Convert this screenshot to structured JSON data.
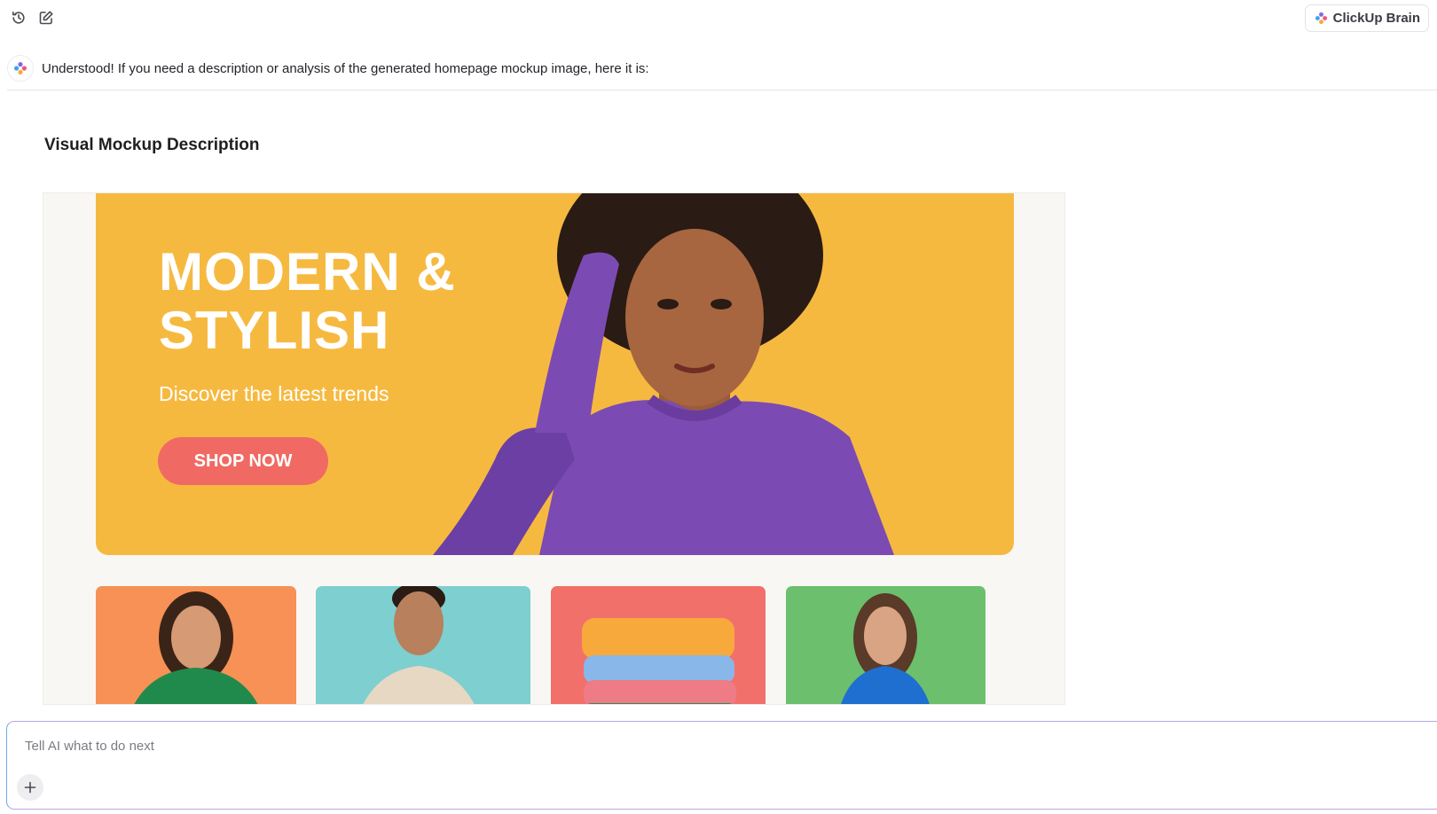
{
  "toolbar": {
    "history_icon": "history-icon",
    "new_chat_icon": "edit-icon"
  },
  "brain_button": {
    "label": "ClickUp Brain",
    "icon": "brain-logo-icon"
  },
  "message": {
    "avatar_icon": "brain-logo-icon",
    "text": "Understood! If you need a description or analysis of the generated homepage mockup image, here it is:"
  },
  "section": {
    "title": "Visual Mockup Description"
  },
  "mockup": {
    "hero": {
      "title_line1": "MODERN &",
      "title_line2": "STYLISH",
      "subtitle": "Discover the latest trends",
      "cta": "SHOP NOW",
      "background_color": "#f6b940",
      "cta_color": "#f06a63"
    },
    "categories": [
      {
        "name": "woman-green-shirt",
        "color": "#f79155"
      },
      {
        "name": "man-beige-shirt",
        "color": "#7ecfcf"
      },
      {
        "name": "folded-sweaters",
        "color": "#f2706a"
      },
      {
        "name": "woman-blue-dress",
        "color": "#6cbf6c"
      }
    ]
  },
  "composer": {
    "placeholder": "Tell AI what to do next",
    "add_icon": "plus-icon"
  }
}
